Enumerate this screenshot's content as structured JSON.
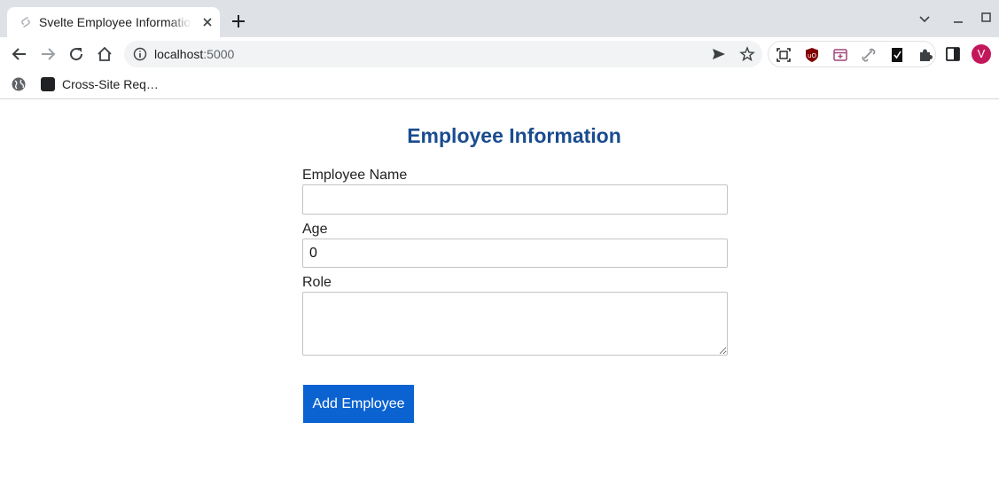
{
  "browser": {
    "tab_title": "Svelte Employee Information",
    "url_host": "localhost",
    "url_port": ":5000",
    "bookmark_label": "Cross-Site Req…",
    "profile_initial": "V"
  },
  "form": {
    "title": "Employee Information",
    "name_label": "Employee Name",
    "name_value": "",
    "age_label": "Age",
    "age_value": "0",
    "role_label": "Role",
    "role_value": "",
    "submit_label": "Add Employee"
  },
  "colors": {
    "title": "#1a4c8f",
    "button": "#0b63d1",
    "avatar": "#c2185b"
  }
}
